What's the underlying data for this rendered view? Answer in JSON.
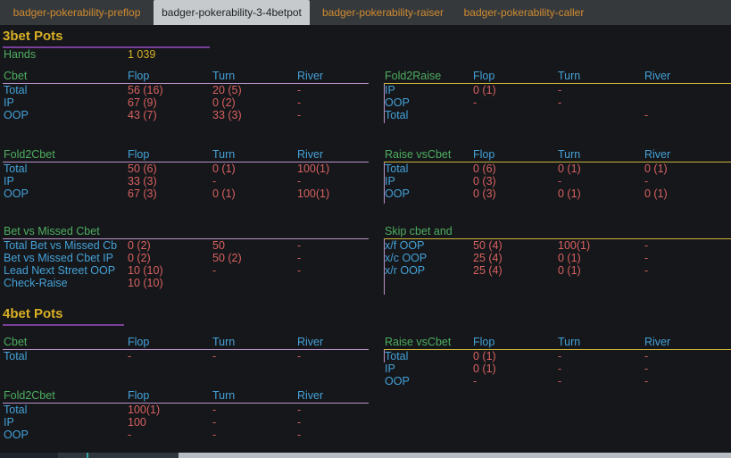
{
  "tabs": [
    {
      "label": "badger-pokerability-preflop",
      "active": false
    },
    {
      "label": "badger-pokerability-3-4betpot",
      "active": true
    },
    {
      "label": "badger-pokerability-raiser",
      "active": false
    },
    {
      "label": "badger-pokerability-caller",
      "active": false
    }
  ],
  "sections": {
    "threebet": {
      "title": "3bet Pots",
      "hands_label": "Hands",
      "hands_value": "1 039"
    },
    "fourbet": {
      "title": "4bet Pots"
    }
  },
  "tables": {
    "cbet3": {
      "name": "Cbet",
      "columns": [
        "Flop",
        "Turn",
        "River"
      ],
      "rows": [
        {
          "label": "Total",
          "values": [
            "56 (16)",
            "20 (5)",
            "-"
          ]
        },
        {
          "label": "IP",
          "values": [
            "67 (9)",
            "0 (2)",
            "-"
          ]
        },
        {
          "label": "OOP",
          "values": [
            "43 (7)",
            "33 (3)",
            "-"
          ]
        }
      ]
    },
    "fold2raise3": {
      "name": "Fold2Raise",
      "columns": [
        "Flop",
        "Turn",
        "River"
      ],
      "rows": [
        {
          "label": "IP",
          "values": [
            "0 (1)",
            "-",
            ""
          ]
        },
        {
          "label": "OOP",
          "values": [
            "-",
            "-",
            ""
          ]
        },
        {
          "label": "Total",
          "values": [
            "",
            "",
            "-"
          ]
        }
      ]
    },
    "fold2cbet3": {
      "name": "Fold2Cbet",
      "columns": [
        "Flop",
        "Turn",
        "River"
      ],
      "rows": [
        {
          "label": "Total",
          "values": [
            "50 (6)",
            "0 (1)",
            "100(1)"
          ]
        },
        {
          "label": "IP",
          "values": [
            "33 (3)",
            "-",
            "-"
          ]
        },
        {
          "label": "OOP",
          "values": [
            "67 (3)",
            "0 (1)",
            "100(1)"
          ]
        }
      ]
    },
    "raisevscbet3": {
      "name": "Raise vsCbet",
      "columns": [
        "Flop",
        "Turn",
        "River"
      ],
      "rows": [
        {
          "label": "Total",
          "values": [
            "0 (6)",
            "0 (1)",
            "0 (1)"
          ]
        },
        {
          "label": "IP",
          "values": [
            "0 (3)",
            "-",
            "-"
          ]
        },
        {
          "label": "OOP",
          "values": [
            "0 (3)",
            "0 (1)",
            "0 (1)"
          ]
        }
      ]
    },
    "betvsmissedcbet3": {
      "name": "Bet vs Missed Cbet",
      "columns": [],
      "rows": [
        {
          "label": "Total Bet vs Missed Cb",
          "values": [
            "0 (2)",
            "50",
            "-"
          ]
        },
        {
          "label": "Bet vs Missed Cbet IP",
          "values": [
            "0 (2)",
            "50 (2)",
            "-"
          ]
        },
        {
          "label": "Lead Next Street OOP",
          "values": [
            "10 (10)",
            "-",
            "-"
          ]
        },
        {
          "label": "Check-Raise",
          "values": [
            "10 (10)"
          ]
        }
      ]
    },
    "skipcbet3": {
      "name": "Skip cbet and",
      "columns": [],
      "rows": [
        {
          "label": "x/f OOP",
          "values": [
            "50 (4)",
            "100(1)",
            "-"
          ]
        },
        {
          "label": "x/c OOP",
          "values": [
            "25 (4)",
            "0 (1)",
            "-"
          ]
        },
        {
          "label": "x/r OOP",
          "values": [
            "25 (4)",
            "0 (1)",
            "-"
          ]
        }
      ]
    },
    "cbet4": {
      "name": "Cbet",
      "columns": [
        "Flop",
        "Turn",
        "River"
      ],
      "rows": [
        {
          "label": "Total",
          "values": [
            "-",
            "-",
            "-"
          ]
        }
      ]
    },
    "raisevscbet4": {
      "name": "Raise vsCbet",
      "columns": [
        "Flop",
        "Turn",
        "River"
      ],
      "rows": [
        {
          "label": "Total",
          "values": [
            "0 (1)",
            "-",
            "-"
          ]
        },
        {
          "label": "IP",
          "values": [
            "0 (1)",
            "-",
            "-"
          ]
        },
        {
          "label": "OOP",
          "values": [
            "-",
            "-",
            "-"
          ]
        }
      ]
    },
    "fold2cbet4": {
      "name": "Fold2Cbet",
      "columns": [
        "Flop",
        "Turn",
        "River"
      ],
      "rows": [
        {
          "label": "Total",
          "values": [
            "100(1)",
            "-",
            "-"
          ]
        },
        {
          "label": "IP",
          "values": [
            "100",
            "-",
            "-"
          ]
        },
        {
          "label": "OOP",
          "values": [
            "-",
            "-",
            "-"
          ]
        }
      ]
    }
  },
  "colors": {
    "background": "#15171a",
    "tabbar_bg": "#36393c",
    "tab_text": "#cf8b30",
    "active_tab_bg": "#c6cacc",
    "heading_gold": "#d9af25",
    "table_name_green": "#4fae60",
    "label_blue": "#45a1d8",
    "value_red": "#d96161",
    "heading_rule_purple": "#7a3f99",
    "left_rule_lavender": "#ba93c9",
    "right_rule_yellow": "#cdb53a"
  }
}
